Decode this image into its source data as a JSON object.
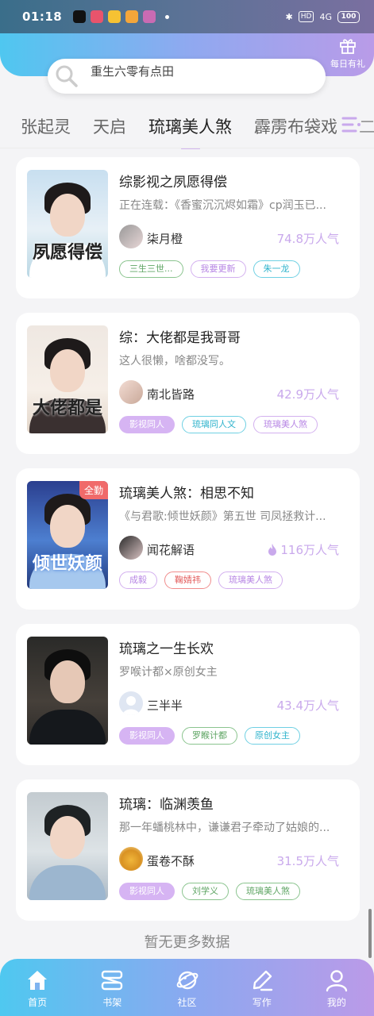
{
  "status_bar": {
    "time": "01:18",
    "network": "4G",
    "hd": "HD",
    "battery": "100"
  },
  "search": {
    "placeholder": "重生六零有点田"
  },
  "gift": {
    "label": "每日有礼"
  },
  "tabs": [
    {
      "label": "张起灵",
      "active": false
    },
    {
      "label": "天启",
      "active": false
    },
    {
      "label": "琉璃美人煞",
      "active": true
    },
    {
      "label": "霹雳布袋戏",
      "active": false
    }
  ],
  "tab_overflow": "二",
  "books": [
    {
      "title": "综影视之夙愿得偿",
      "desc": "正在连载：《香蜜沉沉烬如霜》cp润玉已...",
      "author": "柒月橙",
      "popularity": "74.8万人气",
      "cover_text": "夙愿得偿",
      "badge": "",
      "hot": false,
      "tags": [
        {
          "label": "三生三世...",
          "style": "green"
        },
        {
          "label": "我要更新",
          "style": "purple"
        },
        {
          "label": "朱一龙",
          "style": "cyan"
        }
      ]
    },
    {
      "title": "综：大佬都是我哥哥",
      "desc": "这人很懒，啥都没写。",
      "author": "南北皆路",
      "popularity": "42.9万人气",
      "cover_text": "大佬都是",
      "badge": "",
      "hot": false,
      "tags": [
        {
          "label": "影视同人",
          "style": "filled"
        },
        {
          "label": "琉璃同人文",
          "style": "cyan"
        },
        {
          "label": "琉璃美人煞",
          "style": "purple"
        }
      ]
    },
    {
      "title": "琉璃美人煞：相思不知",
      "desc": "《与君歌:倾世妖颜》第五世 司凤拯救计...",
      "author": "闻花解语",
      "popularity": "116万人气",
      "cover_text": "倾世妖颜",
      "badge": "全勤",
      "hot": true,
      "tags": [
        {
          "label": "成毅",
          "style": "purple"
        },
        {
          "label": "鞠婧祎",
          "style": "red"
        },
        {
          "label": "琉璃美人煞",
          "style": "purple"
        }
      ]
    },
    {
      "title": "琉璃之一生长欢",
      "desc": "罗喉计都×原创女主",
      "author": "三半半",
      "popularity": "43.4万人气",
      "cover_text": "",
      "badge": "",
      "hot": false,
      "tags": [
        {
          "label": "影视同人",
          "style": "filled"
        },
        {
          "label": "罗睺计都",
          "style": "green"
        },
        {
          "label": "原创女主",
          "style": "cyan"
        }
      ]
    },
    {
      "title": "琉璃：临渊羡鱼",
      "desc": "那一年蟠桃林中，谦谦君子牵动了姑娘的...",
      "author": "蛋卷不酥",
      "popularity": "31.5万人气",
      "cover_text": "",
      "badge": "",
      "hot": false,
      "tags": [
        {
          "label": "影视同人",
          "style": "filled"
        },
        {
          "label": "刘学义",
          "style": "green"
        },
        {
          "label": "琉璃美人煞",
          "style": "green"
        }
      ]
    }
  ],
  "no_more": "暂无更多数据",
  "nav": [
    {
      "label": "首页",
      "icon": "home-icon"
    },
    {
      "label": "书架",
      "icon": "bookshelf-icon"
    },
    {
      "label": "社区",
      "icon": "community-icon"
    },
    {
      "label": "写作",
      "icon": "write-icon"
    },
    {
      "label": "我的",
      "icon": "profile-icon"
    }
  ]
}
